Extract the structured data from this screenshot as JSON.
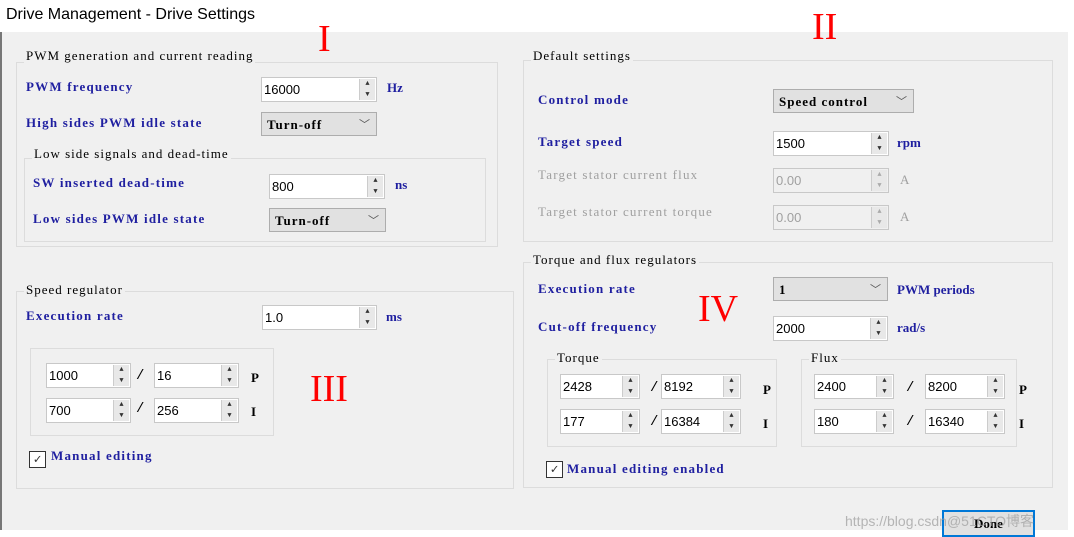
{
  "window": {
    "title": "Drive Management - Drive Settings"
  },
  "annotations": {
    "one": "I",
    "two": "II",
    "three": "III",
    "four": "IV"
  },
  "pwm": {
    "legend": "PWM generation and current reading",
    "freq_label": "PWM frequency",
    "freq_value": "16000",
    "freq_unit": "Hz",
    "high_label": "High sides PWM idle state",
    "high_value": "Turn-off",
    "low_group": {
      "legend": "Low side signals and dead-time",
      "dead_label": "SW inserted dead-time",
      "dead_value": "800",
      "dead_unit": "ns",
      "low_label": "Low sides PWM idle state",
      "low_value": "Turn-off"
    }
  },
  "defaults": {
    "legend": "Default settings",
    "mode_label": "Control mode",
    "mode_value": "Speed control",
    "speed_label": "Target speed",
    "speed_value": "1500",
    "speed_unit": "rpm",
    "flux_label": "Target stator current flux",
    "flux_value": "0.00",
    "flux_unit": "A",
    "torque_label": "Target stator current torque",
    "torque_value": "0.00",
    "torque_unit": "A"
  },
  "speed": {
    "legend": "Speed regulator",
    "rate_label": "Execution rate",
    "rate_value": "1.0",
    "rate_unit": "ms",
    "p_num": "1000",
    "p_den": "16",
    "p_label": "P",
    "i_num": "700",
    "i_den": "256",
    "i_label": "I",
    "manual_label": "Manual editing",
    "manual_checked": true
  },
  "tf": {
    "legend": "Torque and flux regulators",
    "rate_label": "Execution rate",
    "rate_value": "1",
    "rate_unit": "PWM periods",
    "cutoff_label": "Cut-off frequency",
    "cutoff_value": "2000",
    "cutoff_unit": "rad/s",
    "torque": {
      "legend": "Torque",
      "p_num": "2428",
      "p_den": "8192",
      "i_num": "177",
      "i_den": "16384"
    },
    "flux": {
      "legend": "Flux",
      "p_num": "2400",
      "p_den": "8200",
      "i_num": "180",
      "i_den": "16340"
    },
    "p_label": "P",
    "i_label": "I",
    "slash": "/",
    "manual_label": "Manual editing enabled",
    "manual_checked": true
  },
  "footer": {
    "done_label": "Done",
    "watermark": "https://blog.csdn@51CTO博客"
  }
}
